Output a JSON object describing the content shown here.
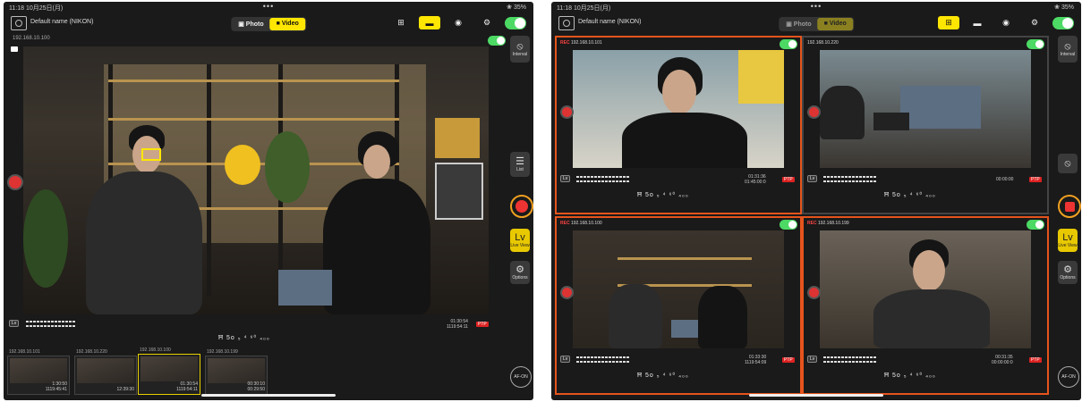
{
  "status_time": "11:18 10月25日(月)",
  "status_dots": "•••",
  "status_battery": "❀ 35%",
  "device_name": "Default name (NIKON)",
  "mode": {
    "photo": "Photo",
    "video": "Video"
  },
  "sidebar": {
    "interval": "Interval",
    "list": "List",
    "lv": "Lv",
    "lv_sub": "Live View",
    "options": "Options",
    "afon": "AF-ON"
  },
  "left": {
    "camera_ip": "192.168.10.100",
    "shutter_info": "Ħ  5o ₅  ⁴ ⁶⁰ ₄₀₀",
    "timecode": "01:30:54\n1119:54:11",
    "ptp": "PTP",
    "thumbnails": [
      {
        "ip": "192.168.10.101",
        "info": "1:30:50\n1119:45:41"
      },
      {
        "ip": "192.168.10.220",
        "info": "12:39:30"
      },
      {
        "ip": "192.168.10.100",
        "info": "01:30:54\n1119:54:11"
      },
      {
        "ip": "192.168.10.199",
        "info": "00:30:10\n00:29:50"
      }
    ]
  },
  "right": {
    "tiles": [
      {
        "rec": "REC",
        "ip": "192.168.10.101",
        "info": "01:31:36\n01:45:00:0",
        "shutter": "Ħ  5o ₅  ⁴ ⁶⁰ ₄₀₀",
        "ptp": "PTP"
      },
      {
        "rec": "",
        "ip": "192.168.10.220",
        "info": "00:00:00",
        "shutter": "Ħ  5o ₅  ⁴ ⁶⁰ ₄₀₀",
        "ptp": "PTP"
      },
      {
        "rec": "REC",
        "ip": "192.168.10.100",
        "info": "01:33:30\n1119:54:09",
        "shutter": "Ħ  5o ₅  ⁴ ⁶⁰ ₄₀₀",
        "ptp": "PTP"
      },
      {
        "rec": "REC",
        "ip": "192.168.10.199",
        "info": "00:31:35\n00:00:00:0",
        "shutter": "Ħ  5o ₅  ⁴ ⁶⁰ ₄₀₀",
        "ptp": "PTP"
      }
    ]
  },
  "colors": {
    "accent_yellow": "#ffe600",
    "rec_red": "#e33",
    "rec_border": "#e5541c",
    "toggle_green": "#4cd964"
  }
}
